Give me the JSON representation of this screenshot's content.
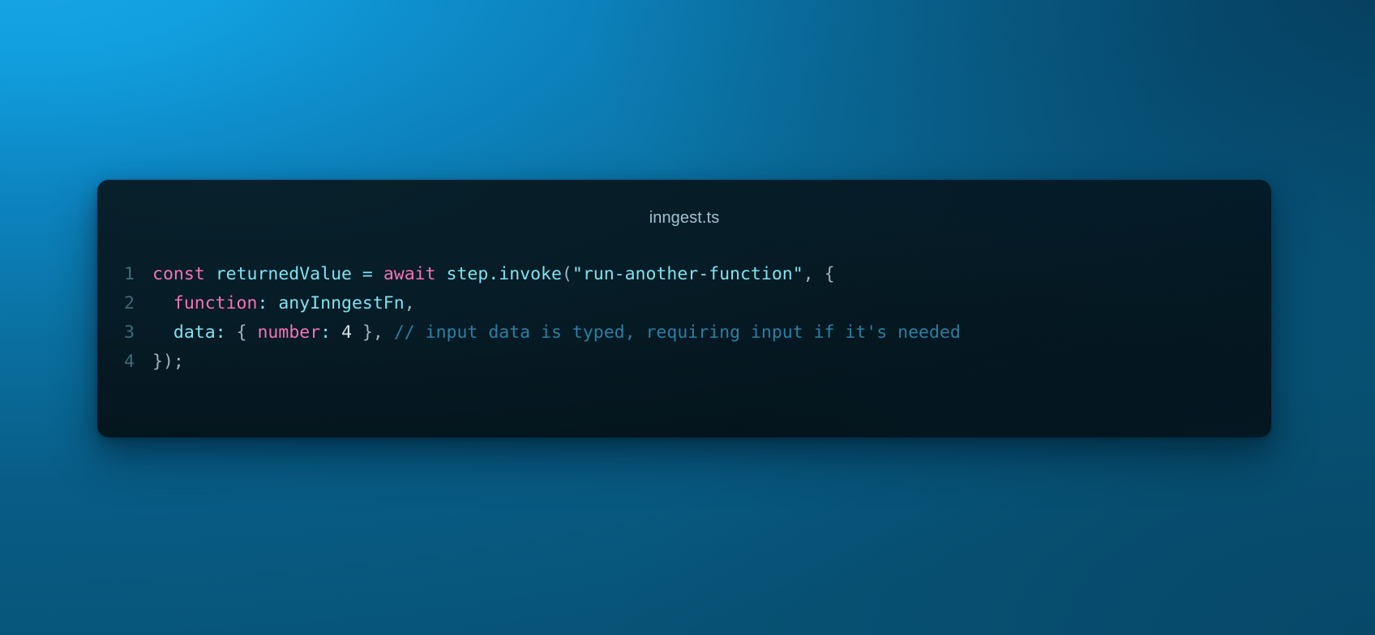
{
  "window": {
    "background_colors": {
      "top_left": "#19a5e6",
      "top_right": "#07536f",
      "bottom_left": "#0e6f9f",
      "bottom_right": "#0a5a84"
    }
  },
  "card": {
    "filename": "inngest.ts",
    "background_color": "#04141c",
    "border_radius_px": 14
  },
  "editor": {
    "language": "typescript",
    "gutter_color": "#3f6b77",
    "line_numbers": [
      "1",
      "2",
      "3",
      "4"
    ],
    "token_colors": {
      "keyword": "#f472b6",
      "identifier": "#7ee3ef",
      "string": "#7ee3ef",
      "number": "#cfe6ec",
      "punctuation": "#a8c3cc",
      "comment": "#2a7fa3"
    },
    "raw_code": "const returnedValue = await step.invoke(\"run-another-function\", {\n  function: anyInngestFn,\n  data: { number: 4 }, // input data is typed, requiring input if it's needed\n});",
    "lines": [
      {
        "number": "1",
        "tokens": [
          {
            "text": "const",
            "type": "keyword"
          },
          {
            "text": " ",
            "type": "plain"
          },
          {
            "text": "returnedValue",
            "type": "identifier"
          },
          {
            "text": " ",
            "type": "plain"
          },
          {
            "text": "=",
            "type": "operator"
          },
          {
            "text": " ",
            "type": "plain"
          },
          {
            "text": "await",
            "type": "keyword"
          },
          {
            "text": " ",
            "type": "plain"
          },
          {
            "text": "step",
            "type": "identifier"
          },
          {
            "text": ".",
            "type": "operator"
          },
          {
            "text": "invoke",
            "type": "identifier"
          },
          {
            "text": "(",
            "type": "punctuation"
          },
          {
            "text": "\"run-another-function\"",
            "type": "string"
          },
          {
            "text": ",",
            "type": "punctuation"
          },
          {
            "text": " ",
            "type": "plain"
          },
          {
            "text": "{",
            "type": "punctuation"
          }
        ]
      },
      {
        "number": "2",
        "tokens": [
          {
            "text": "  ",
            "type": "plain"
          },
          {
            "text": "function",
            "type": "keyword"
          },
          {
            "text": ":",
            "type": "operator"
          },
          {
            "text": " ",
            "type": "plain"
          },
          {
            "text": "anyInngestFn",
            "type": "identifier"
          },
          {
            "text": ",",
            "type": "punctuation"
          }
        ]
      },
      {
        "number": "3",
        "tokens": [
          {
            "text": "  ",
            "type": "plain"
          },
          {
            "text": "data",
            "type": "identifier"
          },
          {
            "text": ":",
            "type": "operator"
          },
          {
            "text": " ",
            "type": "plain"
          },
          {
            "text": "{",
            "type": "punctuation"
          },
          {
            "text": " ",
            "type": "plain"
          },
          {
            "text": "number",
            "type": "keyword"
          },
          {
            "text": ":",
            "type": "operator"
          },
          {
            "text": " ",
            "type": "plain"
          },
          {
            "text": "4",
            "type": "number"
          },
          {
            "text": " ",
            "type": "plain"
          },
          {
            "text": "}",
            "type": "punctuation"
          },
          {
            "text": ",",
            "type": "punctuation"
          },
          {
            "text": " ",
            "type": "plain"
          },
          {
            "text": "// input data is typed, requiring input if it's needed",
            "type": "comment"
          }
        ]
      },
      {
        "number": "4",
        "tokens": [
          {
            "text": "}",
            "type": "punctuation"
          },
          {
            "text": ")",
            "type": "punctuation"
          },
          {
            "text": ";",
            "type": "punctuation"
          }
        ]
      }
    ]
  }
}
